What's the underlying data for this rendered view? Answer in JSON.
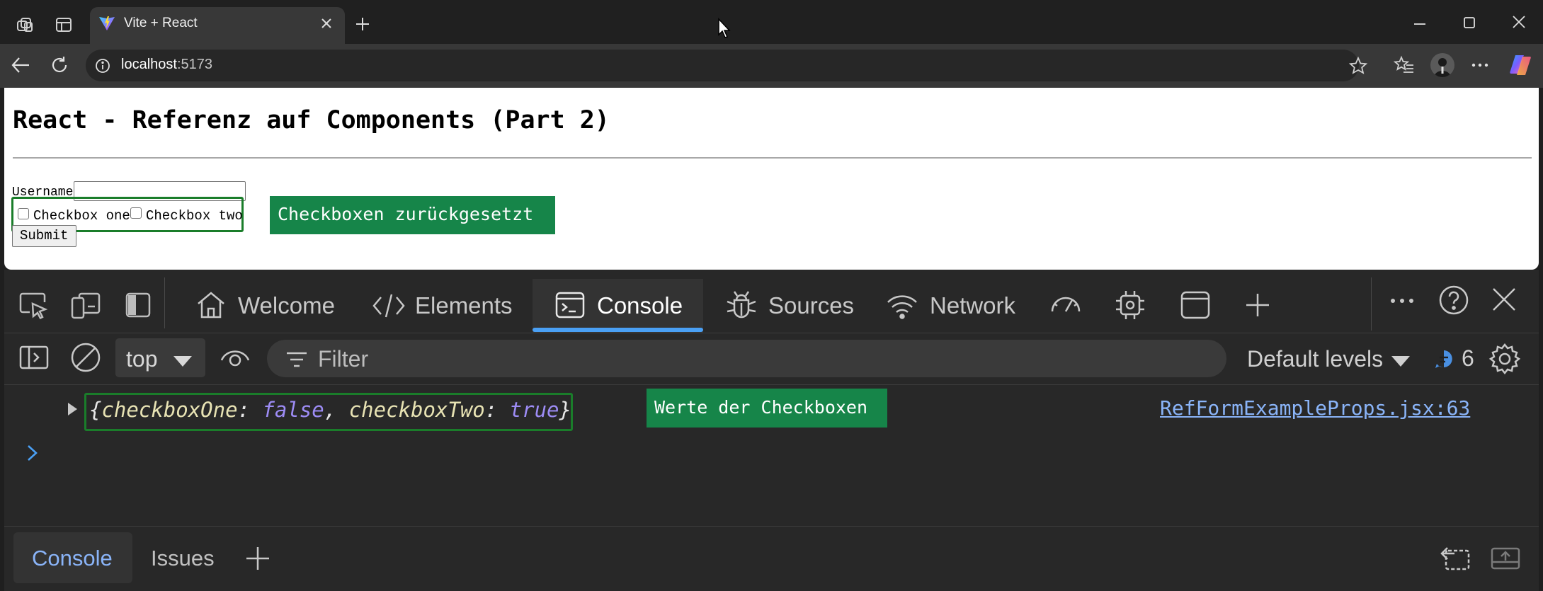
{
  "browser": {
    "tab_title": "Vite + React",
    "url_host": "localhost",
    "url_port": ":5173"
  },
  "page": {
    "title": "React - Referenz auf Components (Part 2)",
    "username_label": "Username",
    "checkbox_one_label": "Checkbox one",
    "checkbox_one_checked": false,
    "checkbox_two_label": "Checkbox two",
    "checkbox_two_checked": false,
    "submit_label": "Submit",
    "annotation": "Checkboxen zurückgesetzt"
  },
  "devtools": {
    "tabs": {
      "welcome": "Welcome",
      "elements": "Elements",
      "console": "Console",
      "sources": "Sources",
      "network": "Network"
    },
    "active_tab": "Console",
    "context": "top",
    "filter_placeholder": "Filter",
    "levels": "Default levels",
    "message_count": "6",
    "log": {
      "open": "{",
      "key1": "checkboxOne",
      "sep1": ": ",
      "val1": "false",
      "comma": ", ",
      "key2": "checkboxTwo",
      "sep2": ": ",
      "val2": "true",
      "close": "}",
      "source": "RefFormExampleProps.jsx:63",
      "annotation": "Werte der Checkboxen"
    },
    "drawer": {
      "console_tab": "Console",
      "issues_tab": "Issues"
    },
    "accent": "#4aa0f5"
  }
}
